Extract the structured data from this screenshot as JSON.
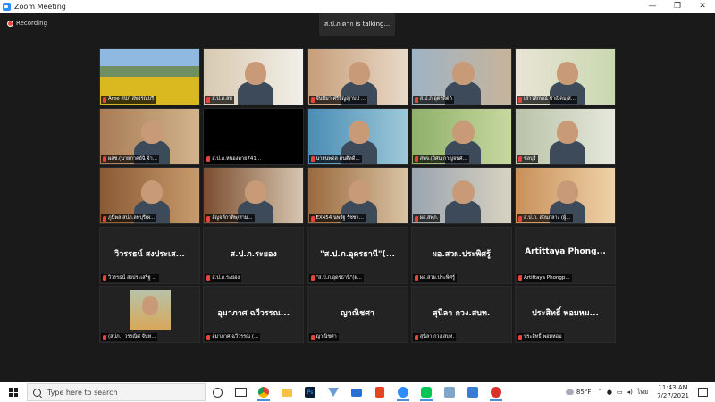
{
  "window": {
    "title": "Zoom Meeting",
    "minimize": "—",
    "maximize": "❐",
    "close": "✕"
  },
  "recording": {
    "label": "Recording"
  },
  "talking": {
    "text": "ส.ป.ภ.ตาก is talking..."
  },
  "participants": [
    {
      "label": "Aree สปภ สพรรณบรี",
      "kind": "video",
      "scene": "field"
    },
    {
      "label": "ส.ป.ภ.ลบ",
      "kind": "video",
      "scene": "office"
    },
    {
      "label": "จันทิมา ศรีปัญญาบป ...",
      "kind": "video",
      "scene": "room"
    },
    {
      "label": "ส.ป.ภ.อุตรดิตถ์",
      "kind": "video",
      "scene": "shelf"
    },
    {
      "label": "เสาวลักษณ์ ปาณิคม/ส...",
      "kind": "video",
      "scene": "flowers"
    },
    {
      "label": "ผสช.(นายภาคย์ฉิ จ้า...",
      "kind": "video",
      "scene": "home"
    },
    {
      "label": "ส.ป.ภ.หนองคาย741...",
      "kind": "video",
      "scene": "black"
    },
    {
      "label": "นายนพดล ต้นติลดิ...",
      "kind": "video",
      "scene": "blue"
    },
    {
      "label": "สพจ.(วิศน กาญจนศ...",
      "kind": "video",
      "scene": "green"
    },
    {
      "label": "ชลบุรี",
      "kind": "video",
      "scene": "window"
    },
    {
      "label": "ภูนิพล สปภ.ลพบุรี(ผ...",
      "kind": "video",
      "scene": "wood"
    },
    {
      "label": "อัญจลีกาทิพ/สาม...",
      "kind": "video",
      "scene": "door"
    },
    {
      "label": "EX454 นพรัฐ รัชชา...",
      "kind": "video",
      "scene": "cabinet"
    },
    {
      "label": "ผอ.สพภ.",
      "kind": "video",
      "scene": "yellow"
    },
    {
      "label": "ส.ป.ภ. ส่วนกลาง (ผู้...",
      "kind": "video",
      "scene": "orange"
    },
    {
      "label": "วิวรรธน์ สงประเสริฐ ...",
      "big": "วิวรรธน์ สงประเส...",
      "kind": "name"
    },
    {
      "label": "ส.ป.ภ.ระยอง",
      "big": "ส.ป.ภ.ระยอง",
      "kind": "name"
    },
    {
      "label": "\"ส.ป.ภ.อุดรธานี\"(ผ...",
      "big": "\"ส.ป.ภ.อุดรธานี\"(...",
      "kind": "name"
    },
    {
      "label": "ผอ.สวผ.ประพิศรู้",
      "big": "ผอ.สวผ.ประพิศรู้",
      "kind": "name"
    },
    {
      "label": "Artittaya Phongp...",
      "big": "Artittaya Phong...",
      "kind": "name"
    },
    {
      "label": "(สปภ.) วรรณิศ จันท...",
      "kind": "avatar"
    },
    {
      "label": "อุมาภาศ ฉวีวรรณ (...",
      "big": "อุมาภาศ ฉวีวรรณ...",
      "kind": "name"
    },
    {
      "label": "ญาณิชศา",
      "big": "ญาณิชศา",
      "kind": "name"
    },
    {
      "label": "สุนิลา กวง.สบท.",
      "big": "สุนิลา กวง.สบท.",
      "kind": "name"
    },
    {
      "label": "ประสิทธิ์ พอมหอม",
      "big": "ประสิทธิ์ พอมหม...",
      "kind": "name"
    }
  ],
  "taskbar": {
    "search_placeholder": "Type here to search",
    "weather": "85°F",
    "language": "ไทย",
    "time": "11:43 AM",
    "date": "7/27/2021"
  }
}
